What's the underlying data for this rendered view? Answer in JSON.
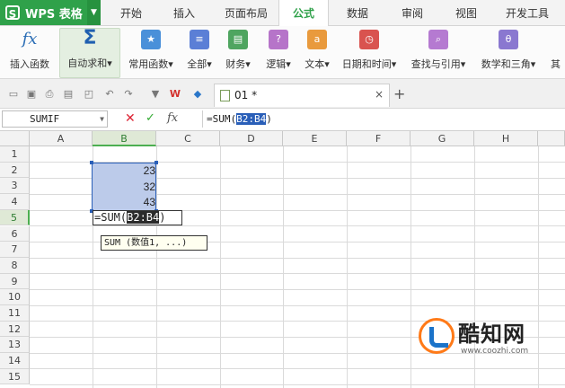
{
  "app": {
    "logo_text": "WPS 表格"
  },
  "menu_tabs": [
    {
      "label": "开始"
    },
    {
      "label": "插入"
    },
    {
      "label": "页面布局"
    },
    {
      "label": "公式",
      "active": true
    },
    {
      "label": "数据"
    },
    {
      "label": "审阅"
    },
    {
      "label": "视图"
    },
    {
      "label": "开发工具"
    }
  ],
  "ribbon": {
    "items": [
      {
        "label": "插入函数",
        "icon": "fx-icon"
      },
      {
        "label": "自动求和▾",
        "icon": "sigma-icon"
      },
      {
        "label": "常用函数▾",
        "icon": "star-book-icon"
      },
      {
        "label": "全部▾",
        "icon": "book-icon"
      },
      {
        "label": "财务▾",
        "icon": "finance-book-icon"
      },
      {
        "label": "逻辑▾",
        "icon": "question-book-icon"
      },
      {
        "label": "文本▾",
        "icon": "text-book-icon"
      },
      {
        "label": "日期和时间▾",
        "icon": "clock-book-icon"
      },
      {
        "label": "查找与引用▾",
        "icon": "search-book-icon"
      },
      {
        "label": "数学和三角▾",
        "icon": "theta-book-icon"
      },
      {
        "label": "其"
      }
    ]
  },
  "document": {
    "tab_name": "01 *",
    "close_glyph": "×",
    "add_glyph": "+"
  },
  "formula_bar": {
    "name_box": "SUMIF",
    "cancel_glyph": "✕",
    "confirm_glyph": "✓",
    "fx_label": "fx",
    "formula_prefix": "=SUM(",
    "formula_range": "B2:B4",
    "formula_suffix": ")"
  },
  "grid": {
    "columns": [
      "A",
      "B",
      "C",
      "D",
      "E",
      "F",
      "G",
      "H"
    ],
    "active_column": "B",
    "rows": [
      "1",
      "2",
      "3",
      "4",
      "5",
      "6",
      "7",
      "8",
      "9",
      "10",
      "11",
      "12",
      "13",
      "14",
      "15"
    ],
    "active_row": "5",
    "cells": {
      "B2": "23",
      "B3": "32",
      "B4": "43"
    },
    "editing_cell": {
      "ref": "B5",
      "prefix": "=SUM(",
      "range": "B2:B4",
      "suffix": ")"
    },
    "tooltip": "SUM (数值1, ...)"
  },
  "watermark": {
    "name": "酷知网",
    "url": "www.coozhi.com"
  }
}
